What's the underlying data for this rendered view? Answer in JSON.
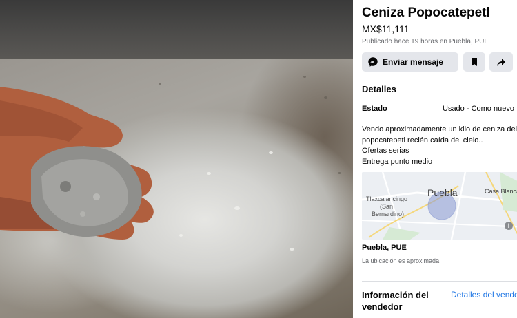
{
  "listing": {
    "title": "Ceniza Popocatepetl",
    "price": "MX$11,111",
    "posted": "Publicado hace 19 horas en Puebla, PUE"
  },
  "actions": {
    "message_label": "Enviar mensaje",
    "message_icon": "messenger-icon",
    "save_icon": "bookmark-icon",
    "share_icon": "share-icon",
    "more_icon": "more-icon",
    "more_glyph": "···"
  },
  "details": {
    "heading": "Detalles",
    "condition_label": "Estado",
    "condition_value": "Usado - Como nuevo",
    "description_lines": [
      "Vendo aproximadamente un kilo de ceniza del",
      "popocatepetl recién caída del cielo..",
      "Ofertas serias",
      "Entrega punto medio"
    ]
  },
  "map": {
    "city": "Puebla",
    "place_east": "Casa Blanca",
    "place_west_line1": "Tlaxcalancingo",
    "place_west_line2": "(San",
    "place_west_line3": "Bernardino)",
    "info_glyph": "i"
  },
  "location": {
    "name": "Puebla, PUE",
    "note": "La ubicación es aproximada"
  },
  "seller": {
    "heading": "Información del vendedor",
    "details_link": "Detalles del vendedor"
  },
  "colors": {
    "accent": "#1b74e4",
    "button_bg": "#e4e6eb",
    "muted_text": "#65676b"
  }
}
